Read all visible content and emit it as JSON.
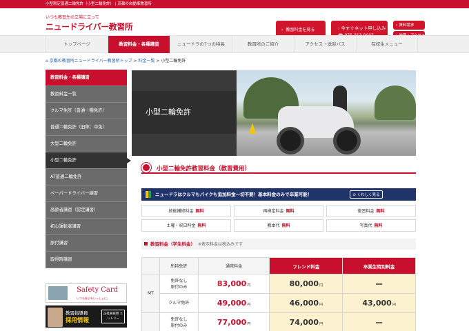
{
  "topbar": {
    "text": "小型限定普通二輪免許（小型二輪免許） | 京都の自動車教習所"
  },
  "header": {
    "tagline": "いつも教習生の立場に立って",
    "logo": "ニュードライバー教習所",
    "fee_button": "教習料金を見る",
    "apply_button": "今すぐネット申し込み",
    "phone": "075-313-9007",
    "request_button": "資料請求",
    "map_button": "地図・アクセス"
  },
  "nav": [
    {
      "label": "トップページ",
      "active": false
    },
    {
      "label": "教習料金・各種講習",
      "active": true
    },
    {
      "label": "ニュードラの7つの特長",
      "active": false
    },
    {
      "label": "教習所のご紹介",
      "active": false
    },
    {
      "label": "アクセス・送迎バス",
      "active": false
    },
    {
      "label": "在校生メニュー",
      "active": false
    }
  ],
  "breadcrumb": {
    "home": "京都の教習所ニュードライバー教習所トップ",
    "sep": " > ",
    "parent": "料金一覧",
    "current": "小型二輪免許"
  },
  "sidebar": {
    "heading": "教習料金・各種講習",
    "items": [
      "教習料金一覧",
      "クルマ免許（普通一種免許）",
      "普通二輪免許（旧称：中免）",
      "大型二輪免許",
      "小型二輪免許",
      "AT普通二輪免許",
      "ペーパードライバー練習",
      "高齢者講習（認定講習）",
      "初心運転者講習",
      "原付講習",
      "取得時講習"
    ],
    "current_index": 4,
    "safety_banner": {
      "title": "Safety Card",
      "sub": "いつも安心をいっしょに。"
    },
    "recruit_banner": {
      "line1": "教習指導員",
      "line2": "採用情報",
      "line3": "正社員採用 エントリー"
    }
  },
  "hero": {
    "title": "小型二輪免許"
  },
  "section": {
    "title": "小型二輪免許教習料金（教習費用）"
  },
  "promo": {
    "text": "ニュードラはクルマもバイクも追加料金一切不要！基本料金のみで卒業可能！",
    "button": "くわしく見る"
  },
  "free_items": [
    {
      "label": "技能補修料金",
      "value": "無料"
    },
    {
      "label": "再検定料金",
      "value": "無料"
    },
    {
      "label": "復習料金",
      "value": "無料"
    },
    {
      "label": "土曜・祝日料金",
      "value": "無料"
    },
    {
      "label": "教本代",
      "value": "無料"
    },
    {
      "label": "写真代",
      "value": "無料"
    }
  ],
  "fee_section": {
    "title": "教習料金（学生料金）",
    "note": "※表示料金は税込みです"
  },
  "table": {
    "headers": [
      "",
      "所持免許",
      "通常料金",
      "フレンド料金",
      "卒業生特別料金"
    ],
    "group_label": "MT",
    "unit": "円",
    "rows": [
      {
        "license": [
          "免許なし",
          "原付のみ"
        ],
        "normal": "83,000",
        "friend": "80,000",
        "graduate": "ー"
      },
      {
        "license": [
          "クルマ免許"
        ],
        "normal": "49,000",
        "friend": "46,000",
        "graduate": "43,000"
      },
      {
        "license": [
          "免許なし",
          "原付のみ"
        ],
        "normal": "77,000",
        "friend": "74,000",
        "graduate": "ー"
      }
    ]
  },
  "colors": {
    "brand_red": "#c8102e",
    "navy": "#20336b",
    "highlight": "#fdf2cf"
  }
}
